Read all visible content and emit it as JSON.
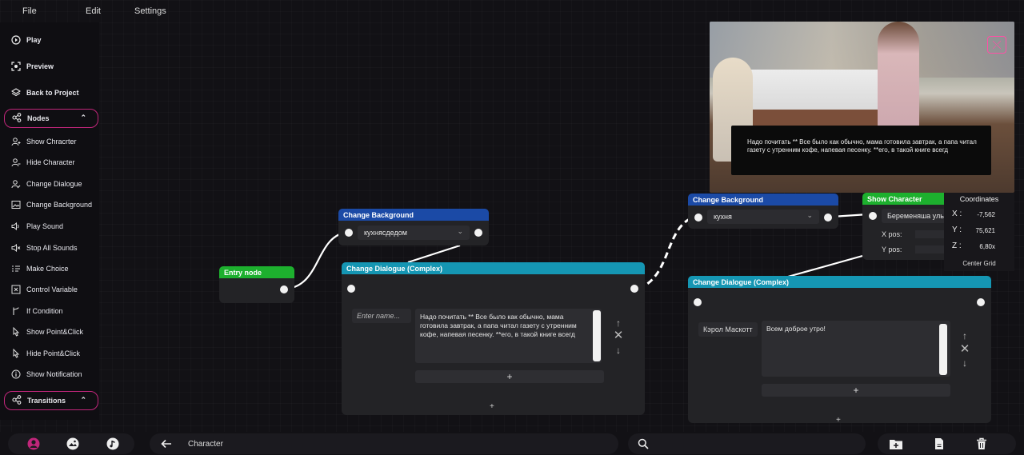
{
  "menu": [
    "File",
    "Edit",
    "Settings"
  ],
  "sidebar": {
    "play": "Play",
    "preview": "Preview",
    "back": "Back to Project",
    "nodes_section": "Nodes",
    "nodes": [
      "Show Chracrter",
      "Hide Character",
      "Change Dialogue",
      "Change Background",
      "Play Sound",
      "Stop All Sounds",
      "Make Choice",
      "Control Variable",
      "If Condition",
      "Show Point&Click",
      "Hide Point&Click",
      "Show Notification"
    ],
    "transitions_section": "Transitions"
  },
  "entry_node": {
    "title": "Entry node"
  },
  "bg_node_1": {
    "title": "Change Background",
    "value": "кухнясдедом"
  },
  "dialogue_1": {
    "title": "Change Dialogue (Complex)",
    "name_placeholder": "Enter name...",
    "text": "Надо почитать ** Все было как обычно, мама готовила завтрак, а папа читал газету с утренним кофе, напевая песенку. **его, в такой книге всегд",
    "add": "+",
    "footer_add": "+"
  },
  "bg_node_2": {
    "title": "Change Background",
    "value": "кухня"
  },
  "show_character": {
    "title": "Show Character",
    "value": "Беременяша уль",
    "xpos_label": "X pos:",
    "ypos_label": "Y pos:"
  },
  "dialogue_2": {
    "title": "Change Dialogue (Complex)",
    "name": "Кэрол Маскотт",
    "text": "Всем доброе утро!",
    "add": "+",
    "footer_add": "+"
  },
  "preview_window": {
    "dialogue_text": "Надо почитать ** Все было как обычно, мама готовила завтрак, а папа читал газету с утренним кофе, напевая песенку. **его, в такой книге всегд"
  },
  "coordinates": {
    "title": "Coordinates",
    "x_label": "X :",
    "x": "-7,562",
    "y_label": "Y :",
    "y": "75,621",
    "z_label": "Z :",
    "z": "6,80x",
    "center": "Center Grid"
  },
  "bottom": {
    "back_label": "Character",
    "search_value": ""
  },
  "colors": {
    "accent": "#c0267a",
    "green_header": "#1db02e",
    "blue_header": "#1b4aa6",
    "teal_header": "#1596b3"
  }
}
